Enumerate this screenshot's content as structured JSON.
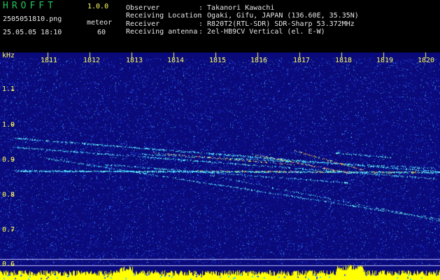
{
  "header": {
    "logo": "HROFFT",
    "version": "1.0.0",
    "filename": "2505051810.png",
    "datetime": "25.05.05 18:10",
    "meteor_label": "meteor",
    "meteor_count": "60",
    "info": [
      {
        "label": "Observer",
        "value": ": Takanori Kawachi"
      },
      {
        "label": "Receiving Location",
        "value": ": Ogaki, Gifu, JAPAN (136.60E, 35.35N)"
      },
      {
        "label": "Receiver",
        "value": ": R820T2(RTL-SDR) SDR-Sharp 53.372MHz"
      },
      {
        "label": "Receiving antenna",
        "value": ": 2el-HB9CV Vertical (el. E-W)"
      }
    ]
  },
  "plot": {
    "y_unit": "kHz",
    "y_ticks": [
      "1.1",
      "1.0",
      "0.9",
      "0.8",
      "0.7",
      "0.6"
    ],
    "x_ticks": [
      "1811",
      "1812",
      "1813",
      "1814",
      "1815",
      "1816",
      "1817",
      "1818",
      "1819",
      "1820"
    ],
    "colors": {
      "background": "#0a0a7a",
      "tick": "#ffff55",
      "bottom_band": "#ffff00"
    }
  }
}
